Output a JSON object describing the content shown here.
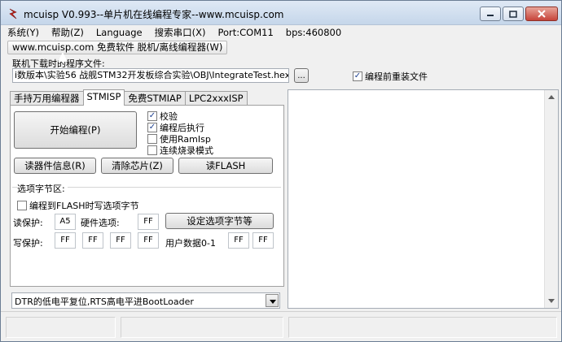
{
  "window": {
    "title": "mcuisp V0.993--单片机在线编程专家--www.mcuisp.com"
  },
  "menu": [
    "系统(Y)",
    "帮助(Z)",
    "Language",
    "搜索串口(X)",
    "Port:COM11",
    "bps:460800"
  ],
  "ad_bar": "www.mcuisp.com 免费软件 脱机/离线编程器(W)",
  "file": {
    "label": "联机下载时的程序文件:",
    "path": "i数版本\\实验56 战舰STM32开发板综合实验\\OBJ\\IntegrateTest.hex",
    "browse_label": "...",
    "reload_label": "编程前重装文件",
    "reload_checked": true
  },
  "tabs": [
    {
      "label": "手持万用编程器",
      "active": false
    },
    {
      "label": "STMISP",
      "active": true
    },
    {
      "label": "免费STMIAP",
      "active": false
    },
    {
      "label": "LPC2xxxISP",
      "active": false
    }
  ],
  "stmisp": {
    "start_label": "开始编程(P)",
    "options": [
      {
        "label": "校验",
        "checked": true
      },
      {
        "label": "编程后执行",
        "checked": true
      },
      {
        "label": "使用RamIsp",
        "checked": false
      },
      {
        "label": "连续烧录模式",
        "checked": false
      }
    ],
    "read_info_label": "读器件信息(R)",
    "erase_label": "清除芯片(Z)",
    "read_flash_label": "读FLASH",
    "option_section_label": "选项字节区:",
    "write_option_label": "编程到FLASH时写选项字节",
    "read_protect_label": "读保护:",
    "read_protect_value": "A5",
    "hw_option_label": "硬件选项:",
    "hw_option_value": "FF",
    "set_option_label": "设定选项字节等",
    "write_protect_label": "写保护:",
    "write_protect_values": [
      "FF",
      "FF",
      "FF",
      "FF"
    ],
    "user_data_label": "用户数据0-1",
    "user_data_values": [
      "FF",
      "FF"
    ],
    "boot_mode": "DTR的低电平复位,RTS高电平进BootLoader"
  },
  "colors": {
    "title_gradient_top": "#dfe9f5",
    "close_button": "#c7443a",
    "icon_red": "#d0261e"
  }
}
